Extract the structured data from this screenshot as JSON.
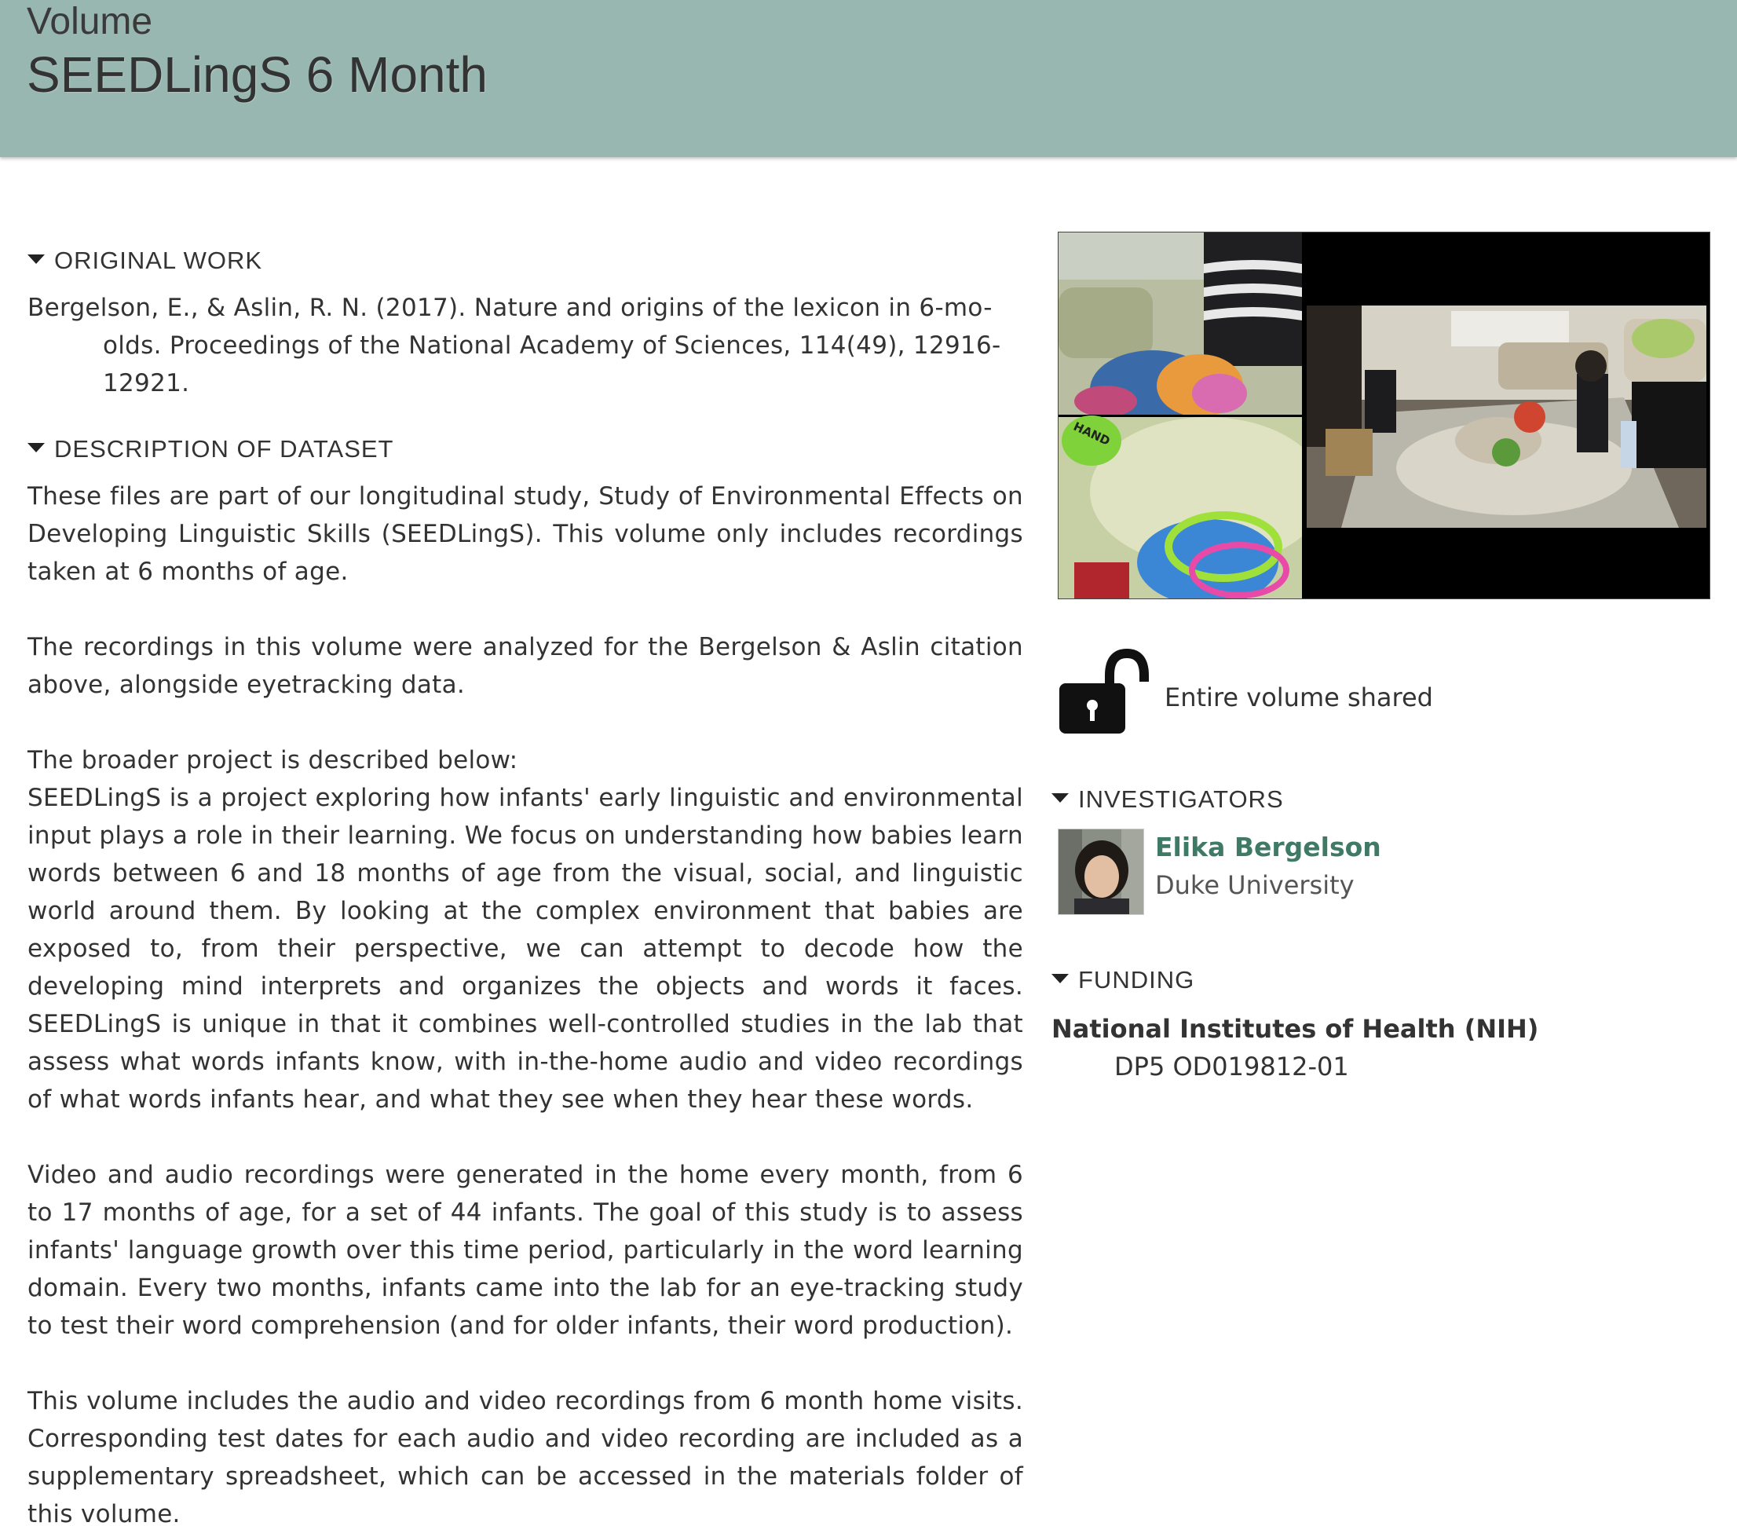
{
  "header": {
    "label": "Volume",
    "title": "SEEDLingS 6 Month"
  },
  "original_work": {
    "heading": "ORIGINAL WORK",
    "citation": "Bergelson, E., & Aslin, R. N. (2017). Nature and origins of the lexicon in 6-mo-olds. Proceedings of the National Academy of Sciences, 114(49), 12916-12921."
  },
  "description": {
    "heading": "DESCRIPTION OF DATASET",
    "paragraphs": [
      "These files are part of our longitudinal study, Study of Environmental Effects on Developing Linguistic Skills (SEEDLingS). This volume only includes recordings taken at 6 months of age.",
      "The recordings in this volume were analyzed for the Bergelson & Aslin citation above, alongside eyetracking data.",
      "The broader project is described below:",
      "SEEDLingS is a project exploring how infants' early linguistic and environmental input plays a role in their learning. We focus on understanding how babies learn words between 6 and 18 months of age from the visual, social, and linguistic world around them. By looking at the complex environment that babies are exposed to, from their perspective, we can attempt to decode how the developing mind interprets and organizes the objects and words it faces. SEEDLingS is unique in that it combines well-controlled studies in the lab that assess what words infants know, with in-the-home audio and video recordings of what words infants hear, and what they see when they hear these words.",
      "Video and audio recordings were generated in the home every month, from 6 to 17 months of age, for a set of 44 infants. The goal of this study is to assess infants' language growth over this time period, particularly in the word learning domain. Every two months, infants came into the lab for an eye-tracking study to test their word comprehension (and for older infants, their word production).",
      "This volume includes the audio and video recordings from 6 month home visits. Corresponding test dates for each audio and video recording are included as a supplementary spreadsheet, which can be accessed in the materials folder of this volume."
    ]
  },
  "thumbnail": {
    "toy_label": "HAND"
  },
  "access": {
    "icon": "unlock-icon",
    "text": "Entire volume shared"
  },
  "investigators": {
    "heading": "INVESTIGATORS",
    "items": [
      {
        "name": "Elika Bergelson",
        "institution": "Duke University"
      }
    ]
  },
  "funding": {
    "heading": "FUNDING",
    "items": [
      {
        "funder": "National Institutes of Health (NIH)",
        "award": "DP5 OD019812-01"
      }
    ]
  },
  "colors": {
    "header_bg": "#98b7b0",
    "link": "#3f7a66"
  }
}
